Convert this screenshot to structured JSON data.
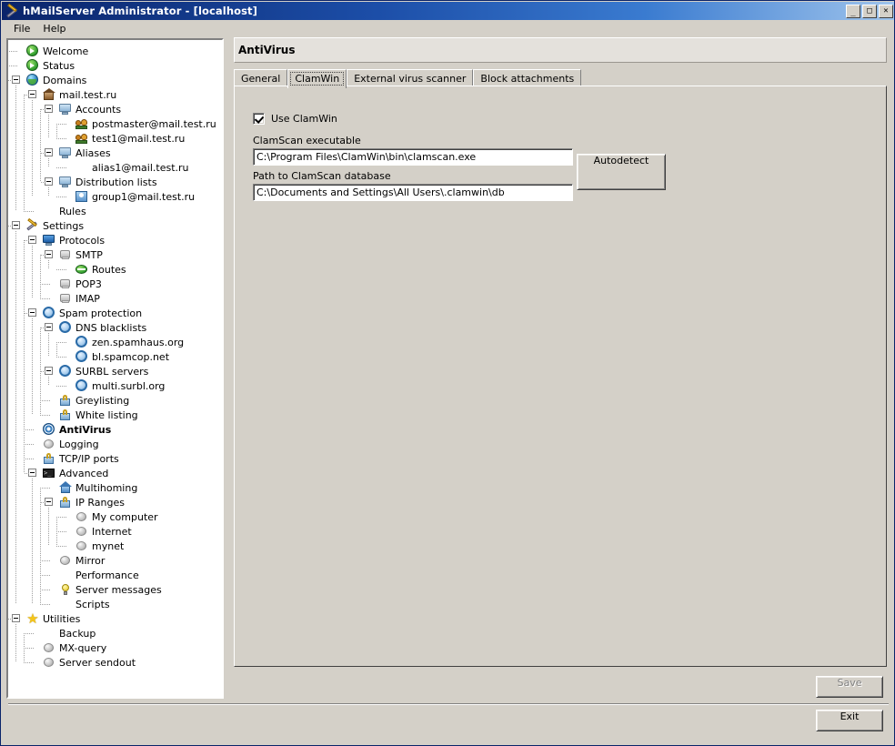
{
  "window": {
    "title": "hMailServer Administrator - [localhost]",
    "icon": "tools-icon",
    "controls": {
      "minimize": "_",
      "maximize": "□",
      "close": "✕"
    }
  },
  "menubar": {
    "items": [
      "File",
      "Help"
    ]
  },
  "tree": {
    "nodes": [
      {
        "label": "Welcome",
        "depth": 1,
        "icon": "green-arrow-icon",
        "expander": "none",
        "selected": false
      },
      {
        "label": "Status",
        "depth": 1,
        "icon": "green-arrow-icon",
        "expander": "none",
        "selected": false
      },
      {
        "label": "Domains",
        "depth": 1,
        "icon": "globe-icon",
        "expander": "expanded",
        "selected": false
      },
      {
        "label": "mail.test.ru",
        "depth": 2,
        "icon": "home-icon",
        "expander": "expanded",
        "selected": false
      },
      {
        "label": "Accounts",
        "depth": 3,
        "icon": "monitor-icon",
        "expander": "expanded",
        "selected": false
      },
      {
        "label": "postmaster@mail.test.ru",
        "depth": 4,
        "icon": "users-icon",
        "expander": "none",
        "selected": false
      },
      {
        "label": "test1@mail.test.ru",
        "depth": 4,
        "icon": "users-icon",
        "expander": "none",
        "selected": false
      },
      {
        "label": "Aliases",
        "depth": 3,
        "icon": "monitor-icon",
        "expander": "expanded",
        "selected": false
      },
      {
        "label": "alias1@mail.test.ru",
        "depth": 4,
        "icon": "double-arrow-icon",
        "expander": "none",
        "selected": false
      },
      {
        "label": "Distribution lists",
        "depth": 3,
        "icon": "monitor-icon",
        "expander": "expanded",
        "selected": false
      },
      {
        "label": "group1@mail.test.ru",
        "depth": 4,
        "icon": "group-icon",
        "expander": "none",
        "selected": false
      },
      {
        "label": "Rules",
        "depth": 2,
        "icon": "document-icon",
        "expander": "none",
        "selected": false
      },
      {
        "label": "Settings",
        "depth": 1,
        "icon": "tools-icon",
        "expander": "expanded",
        "selected": false
      },
      {
        "label": "Protocols",
        "depth": 2,
        "icon": "monitor-blue-icon",
        "expander": "expanded",
        "selected": false
      },
      {
        "label": "SMTP",
        "depth": 3,
        "icon": "server-icon",
        "expander": "expanded",
        "selected": false
      },
      {
        "label": "Routes",
        "depth": 4,
        "icon": "ellipse-green-icon",
        "expander": "none",
        "selected": false
      },
      {
        "label": "POP3",
        "depth": 3,
        "icon": "server-icon",
        "expander": "none",
        "selected": false
      },
      {
        "label": "IMAP",
        "depth": 3,
        "icon": "server-icon",
        "expander": "none",
        "selected": false
      },
      {
        "label": "Spam protection",
        "depth": 2,
        "icon": "circle-blue-icon",
        "expander": "expanded",
        "selected": false
      },
      {
        "label": "DNS blacklists",
        "depth": 3,
        "icon": "circle-blue-icon",
        "expander": "expanded",
        "selected": false
      },
      {
        "label": "zen.spamhaus.org",
        "depth": 4,
        "icon": "circle-blue-icon",
        "expander": "none",
        "selected": false
      },
      {
        "label": "bl.spamcop.net",
        "depth": 4,
        "icon": "circle-blue-icon",
        "expander": "none",
        "selected": false
      },
      {
        "label": "SURBL servers",
        "depth": 3,
        "icon": "circle-blue-icon",
        "expander": "expanded",
        "selected": false
      },
      {
        "label": "multi.surbl.org",
        "depth": 4,
        "icon": "circle-blue-icon",
        "expander": "none",
        "selected": false
      },
      {
        "label": "Greylisting",
        "depth": 3,
        "icon": "lock-icon",
        "expander": "none",
        "selected": false
      },
      {
        "label": "White listing",
        "depth": 3,
        "icon": "lock-icon",
        "expander": "none",
        "selected": false
      },
      {
        "label": "AntiVirus",
        "depth": 2,
        "icon": "target-icon",
        "expander": "none",
        "selected": true
      },
      {
        "label": "Logging",
        "depth": 2,
        "icon": "gray-ball-icon",
        "expander": "none",
        "selected": false
      },
      {
        "label": "TCP/IP ports",
        "depth": 2,
        "icon": "lock-icon",
        "expander": "none",
        "selected": false
      },
      {
        "label": "Advanced",
        "depth": 2,
        "icon": "console-icon",
        "expander": "expanded",
        "selected": false
      },
      {
        "label": "Multihoming",
        "depth": 3,
        "icon": "house-blue-icon",
        "expander": "none",
        "selected": false
      },
      {
        "label": "IP Ranges",
        "depth": 3,
        "icon": "lock-icon",
        "expander": "expanded",
        "selected": false
      },
      {
        "label": "My computer",
        "depth": 4,
        "icon": "gray-ball-icon",
        "expander": "none",
        "selected": false
      },
      {
        "label": "Internet",
        "depth": 4,
        "icon": "gray-ball-icon",
        "expander": "none",
        "selected": false
      },
      {
        "label": "mynet",
        "depth": 4,
        "icon": "gray-ball-icon",
        "expander": "none",
        "selected": false
      },
      {
        "label": "Mirror",
        "depth": 3,
        "icon": "gray-ball-icon",
        "expander": "none",
        "selected": false
      },
      {
        "label": "Performance",
        "depth": 3,
        "icon": "double-arrow-icon",
        "expander": "none",
        "selected": false
      },
      {
        "label": "Server messages",
        "depth": 3,
        "icon": "bulb-icon",
        "expander": "none",
        "selected": false
      },
      {
        "label": "Scripts",
        "depth": 3,
        "icon": "document-icon",
        "expander": "none",
        "selected": false
      },
      {
        "label": "Utilities",
        "depth": 1,
        "icon": "star-icon",
        "expander": "expanded",
        "selected": false
      },
      {
        "label": "Backup",
        "depth": 2,
        "icon": "document-icon",
        "expander": "none",
        "selected": false
      },
      {
        "label": "MX-query",
        "depth": 2,
        "icon": "gray-ball-icon",
        "expander": "none",
        "selected": false
      },
      {
        "label": "Server sendout",
        "depth": 2,
        "icon": "gray-ball-icon",
        "expander": "none",
        "selected": false
      }
    ]
  },
  "content": {
    "header_title": "AntiVirus",
    "tabs": [
      {
        "label": "General",
        "active": false
      },
      {
        "label": "ClamWin",
        "active": true
      },
      {
        "label": "External virus scanner",
        "active": false
      },
      {
        "label": "Block attachments",
        "active": false
      }
    ],
    "clamwin": {
      "use_clamwin_label": "Use ClamWin",
      "use_clamwin_checked": true,
      "executable_label": "ClamScan executable",
      "executable_value": "C:\\Program Files\\ClamWin\\bin\\clamscan.exe",
      "database_label": "Path to ClamScan database",
      "database_value": "C:\\Documents and Settings\\All Users\\.clamwin\\db",
      "autodetect_label": "Autodetect"
    }
  },
  "footer": {
    "save_label": "Save",
    "save_disabled": true,
    "exit_label": "Exit"
  }
}
